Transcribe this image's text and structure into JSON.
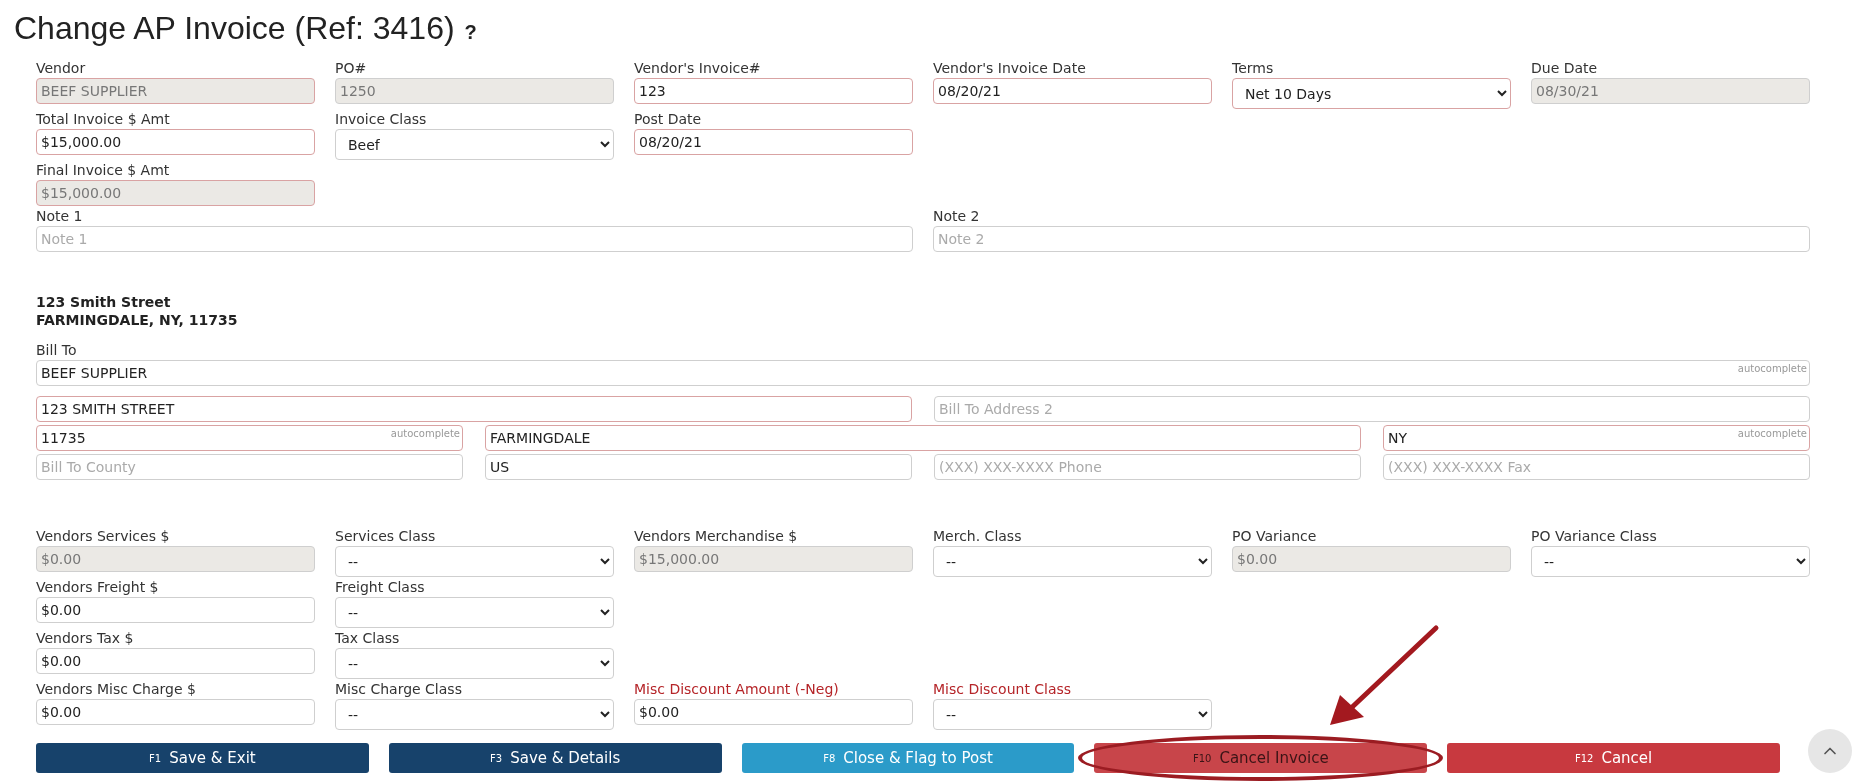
{
  "title": "Change AP Invoice (Ref: 3416)",
  "help": "?",
  "invoice_rows": [
    [
      {
        "label": "Vendor",
        "kind": "text",
        "value": "BEEF SUPPLIER",
        "required": true,
        "disabled": true
      },
      {
        "label": "PO#",
        "kind": "text",
        "value": "1250",
        "required": false,
        "disabled": true
      },
      {
        "label": "Vendor's Invoice#",
        "kind": "text",
        "value": "123",
        "required": true,
        "disabled": false
      },
      {
        "label": "Vendor's Invoice Date",
        "kind": "text",
        "value": "08/20/21",
        "required": true,
        "disabled": false
      },
      {
        "label": "Terms",
        "kind": "select",
        "value": "Net 10 Days",
        "required": true
      },
      {
        "label": "Due Date",
        "kind": "text",
        "value": "08/30/21",
        "required": false,
        "disabled": true
      }
    ],
    [
      {
        "label": "Total Invoice $ Amt",
        "kind": "text",
        "value": "$15,000.00",
        "required": true,
        "disabled": false
      },
      {
        "label": "Invoice Class",
        "kind": "select",
        "value": "Beef",
        "required": false
      },
      {
        "label": "Post Date",
        "kind": "text",
        "value": "08/20/21",
        "required": true,
        "disabled": false
      }
    ],
    [
      {
        "label": "Final Invoice $ Amt",
        "kind": "text",
        "value": "$15,000.00",
        "required": true,
        "disabled": true
      }
    ]
  ],
  "notes": [
    {
      "label": "Note 1",
      "kind": "text",
      "placeholder": "Note 1",
      "required": false,
      "disabled": false
    },
    {
      "label": "Note 2",
      "kind": "text",
      "placeholder": "Note 2",
      "required": false,
      "disabled": false
    }
  ],
  "address_header": [
    "123 Smith Street",
    "FARMINGDALE, NY, 11735"
  ],
  "address": {
    "bill_to": {
      "label": "Bill To",
      "kind": "text",
      "value": "BEEF SUPPLIER",
      "hint": "autocomplete",
      "required": false,
      "disabled": false
    },
    "line1": {
      "kind": "text",
      "value": "123 SMITH STREET",
      "required": true,
      "disabled": false
    },
    "line2": {
      "kind": "text",
      "placeholder": "Bill To Address 2",
      "required": false,
      "disabled": false
    },
    "zip": {
      "kind": "text",
      "value": "11735",
      "hint": "autocomplete",
      "required": true,
      "disabled": false
    },
    "city": {
      "kind": "text",
      "value": "FARMINGDALE",
      "required": true,
      "disabled": false
    },
    "state": {
      "kind": "text",
      "value": "NY",
      "hint": "autocomplete",
      "required": true,
      "disabled": false
    },
    "county": {
      "kind": "text",
      "placeholder": "Bill To County",
      "required": false,
      "disabled": false
    },
    "country": {
      "kind": "text",
      "value": "US",
      "required": false,
      "disabled": false
    },
    "phone": {
      "kind": "text",
      "placeholder": "(XXX) XXX-XXXX Phone",
      "required": false,
      "disabled": false
    },
    "fax": {
      "kind": "text",
      "placeholder": "(XXX) XXX-XXXX Fax",
      "required": false,
      "disabled": false
    }
  },
  "amount_rows": [
    [
      {
        "label": "Vendors Services $",
        "kind": "text",
        "value": "$0.00",
        "required": false,
        "disabled": true
      },
      {
        "label": "Services Class",
        "kind": "select",
        "value": "--",
        "required": false
      },
      {
        "label": "Vendors Merchandise $",
        "kind": "text",
        "value": "$15,000.00",
        "required": false,
        "disabled": true
      },
      {
        "label": "Merch. Class",
        "kind": "select",
        "value": "--",
        "required": false
      },
      {
        "label": "PO Variance",
        "kind": "text",
        "value": "$0.00",
        "required": false,
        "disabled": true
      },
      {
        "label": "PO Variance Class",
        "kind": "select",
        "value": "--",
        "required": false
      }
    ],
    [
      {
        "label": "Vendors Freight $",
        "kind": "text",
        "value": "$0.00",
        "required": false,
        "disabled": false
      },
      {
        "label": "Freight Class",
        "kind": "select",
        "value": "--",
        "required": false
      }
    ],
    [
      {
        "label": "Vendors Tax $",
        "kind": "text",
        "value": "$0.00",
        "required": false,
        "disabled": false
      },
      {
        "label": "Tax Class",
        "kind": "select",
        "value": "--",
        "required": false
      }
    ],
    [
      {
        "label": "Vendors Misc Charge $",
        "kind": "text",
        "value": "$0.00",
        "required": false,
        "disabled": false
      },
      {
        "label": "Misc Charge Class",
        "kind": "select",
        "value": "--",
        "required": false
      },
      {
        "label": "Misc Discount Amount (-Neg)",
        "kind": "text",
        "value": "$0.00",
        "required": false,
        "disabled": false,
        "color": "#b52428"
      },
      {
        "label": "Misc Discount Class",
        "kind": "select",
        "value": "--",
        "required": false,
        "color": "#b52428"
      }
    ]
  ],
  "buttons": [
    {
      "key": "F1",
      "label": "Save & Exit",
      "color": "#17426b",
      "highlighted": false
    },
    {
      "key": "F3",
      "label": "Save & Details",
      "color": "#17426b",
      "highlighted": false
    },
    {
      "key": "F8",
      "label": "Close & Flag to Post",
      "color": "#2b9bc9",
      "highlighted": false
    },
    {
      "key": "F10",
      "label": "Cancel Invoice",
      "color": "#c8454a",
      "highlighted": true
    },
    {
      "key": "F12",
      "label": "Cancel",
      "color": "#c8393f",
      "highlighted": false
    }
  ]
}
